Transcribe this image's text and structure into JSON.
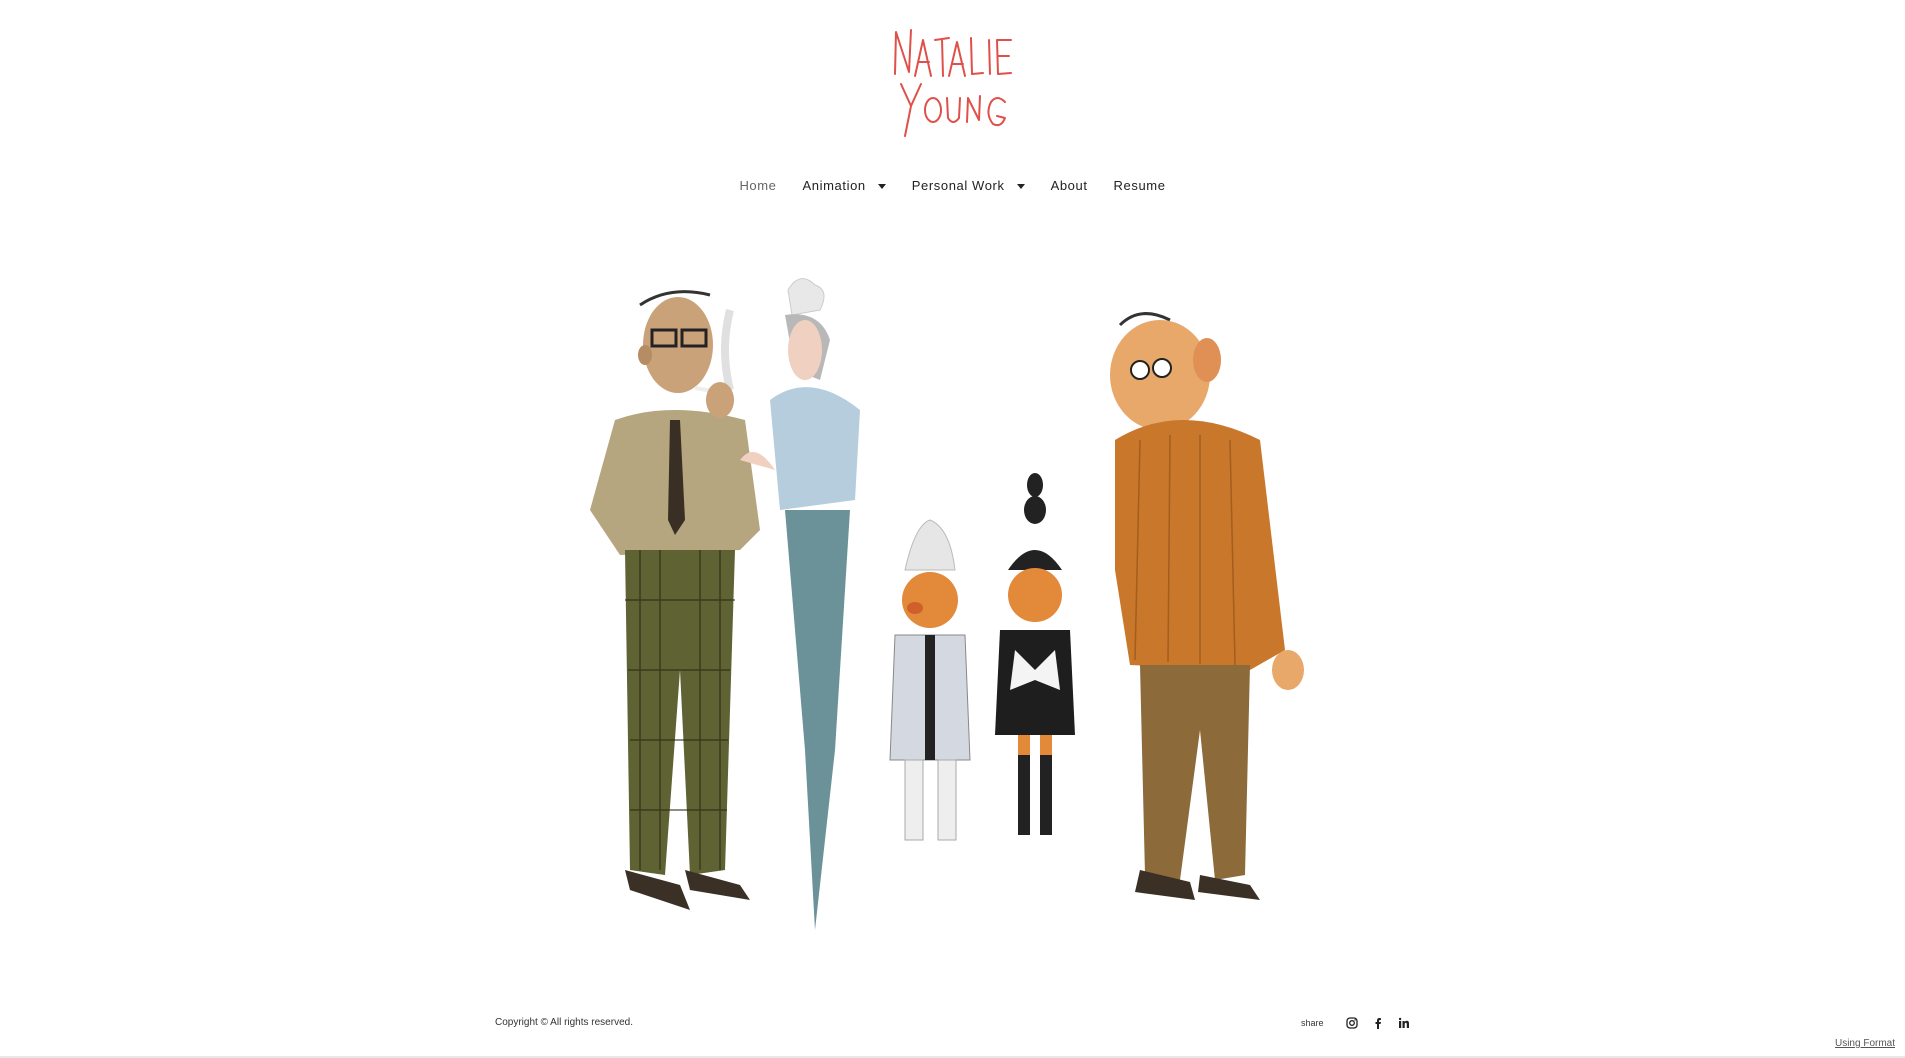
{
  "site": {
    "logo_text_line1": "NATALIE",
    "logo_text_line2": "YOUNG",
    "logo_color": "#e0504a"
  },
  "nav": {
    "items": [
      {
        "label": "Home",
        "active": true,
        "has_dropdown": false
      },
      {
        "label": "Animation",
        "active": false,
        "has_dropdown": true
      },
      {
        "label": "Personal Work",
        "active": false,
        "has_dropdown": true
      },
      {
        "label": "About",
        "active": false,
        "has_dropdown": false
      },
      {
        "label": "Resume",
        "active": false,
        "has_dropdown": false
      }
    ]
  },
  "footer": {
    "copyright": "Copyright © All rights reserved.",
    "share_label": "share",
    "social_icons": [
      "instagram-icon",
      "facebook-icon",
      "linkedin-icon"
    ],
    "using_format": "Using Format"
  }
}
